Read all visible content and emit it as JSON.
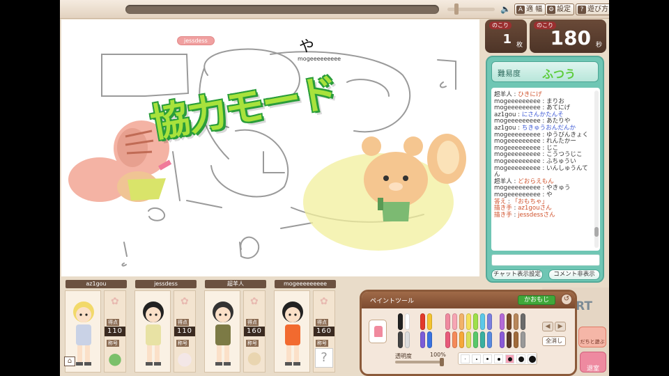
{
  "topbar": {
    "buttons": [
      {
        "label": "適 幅",
        "icon": "A"
      },
      {
        "label": "設定",
        "icon": "⚙"
      },
      {
        "label": "遊び方",
        "icon": "?"
      }
    ]
  },
  "canvas": {
    "drawer_tag": "jessdess",
    "hint_char": "や",
    "hint_name": "mogeeeeeeeee",
    "mode_title": "協力モード"
  },
  "counters": {
    "sheets": {
      "label": "のこり",
      "value": "1",
      "unit": "枚"
    },
    "time": {
      "label": "のこり",
      "value": "180",
      "unit": "秒"
    }
  },
  "difficulty": {
    "label": "難易度",
    "value": "ふつう"
  },
  "chat": {
    "lines": [
      {
        "who": "超羊人",
        "sep": " : ",
        "msg": "ひきにげ",
        "style": "red"
      },
      {
        "who": "mogeeeeeeeee",
        "sep": " : ",
        "msg": "まりお",
        "style": ""
      },
      {
        "who": "mogeeeeeeeee",
        "sep": " : ",
        "msg": "あてにげ",
        "style": ""
      },
      {
        "who": "az1gou",
        "sep": " : ",
        "msg": "にさんかたんそ",
        "style": "blue"
      },
      {
        "who": "mogeeeeeeeee",
        "sep": " : ",
        "msg": "あたりや",
        "style": ""
      },
      {
        "who": "az1gou",
        "sep": " : ",
        "msg": "ちきゅうおんだんか",
        "style": "blue"
      },
      {
        "who": "mogeeeeeeeee",
        "sep": " : ",
        "msg": "ゆうびんきょく",
        "style": ""
      },
      {
        "who": "mogeeeeeeeee",
        "sep": " : ",
        "msg": "れんたかー",
        "style": ""
      },
      {
        "who": "mogeeeeeeeee",
        "sep": " : ",
        "msg": "じこ",
        "style": ""
      },
      {
        "who": "mogeeeeeeeee",
        "sep": " : ",
        "msg": "こうつうじこ",
        "style": ""
      },
      {
        "who": "mogeeeeeeeee",
        "sep": " : ",
        "msg": "ふちゅうい",
        "style": ""
      },
      {
        "who": "mogeeeeeeeee",
        "sep": " : ",
        "msg": "いんしゅうんてん",
        "style": ""
      },
      {
        "who": "超羊人",
        "sep": " : ",
        "msg": "どおらえもん",
        "style": "red"
      },
      {
        "who": "mogeeeeeeeee",
        "sep": " : ",
        "msg": "やきゅう",
        "style": ""
      },
      {
        "who": "mogeeeeeeeee",
        "sep": " : ",
        "msg": "や",
        "style": ""
      },
      {
        "who": "答え",
        "sep": " : ",
        "msg": "「おもちゃ」",
        "style": "sys"
      },
      {
        "who": "描き手",
        "sep": " : ",
        "msg": "az1gouさん",
        "style": "sys"
      },
      {
        "who": "描き手",
        "sep": " : ",
        "msg": "jessdessさん",
        "style": "sys"
      }
    ],
    "input_value": "",
    "display_settings_label": "チャット表示設定",
    "comment_hide_label": "コメント非表示"
  },
  "players": [
    {
      "name": "az1gou",
      "score_label": "得点",
      "score": "110",
      "title_label": "称号",
      "hair": "#f2d96a",
      "outfit": "#c9d2e6",
      "badge": "green"
    },
    {
      "name": "jessdess",
      "score_label": "得点",
      "score": "110",
      "title_label": "称号",
      "hair": "#222222",
      "outfit": "#e8e2a4",
      "badge": "cat"
    },
    {
      "name": "超羊人",
      "score_label": "得点",
      "score": "160",
      "title_label": "称号",
      "hair": "#333333",
      "outfit": "#7c7a45",
      "badge": "face"
    },
    {
      "name": "mogeeeeeeeee",
      "score_label": "得点",
      "score": "160",
      "title_label": "称号",
      "hair": "#222222",
      "outfit": "#f26a2f",
      "badge": "?"
    }
  ],
  "paint_tool": {
    "title": "ペイントツール",
    "kaomoji_label": "かおもじ",
    "clear_all_label": "全消し",
    "opacity_label": "透明度",
    "opacity_value": "100%",
    "pens_row1": [
      "#222222",
      "#ffffff",
      "#e23a2a",
      "#f4c430",
      "#f08aa0",
      "#f7a6b4",
      "#f2b36a",
      "#f5e05a",
      "#9ee04a",
      "#5cc8e8",
      "#7b7fe0",
      "#b46ad8",
      "#7a4b2a",
      "#b8875a",
      "#6b6b6b"
    ],
    "pens_row2": [
      "#444444",
      "#dddddd",
      "#7b5cd8",
      "#3a72e0",
      "#e85a7a",
      "#f58a5a",
      "#f6a83a",
      "#d8e05a",
      "#5ac86a",
      "#3ab0a0",
      "#5a8ae0",
      "#8a5ad8",
      "#5a3a2a",
      "#a06a3a",
      "#999999"
    ],
    "sizes": [
      "1",
      "2",
      "3",
      "5",
      "7",
      "9",
      "50"
    ]
  },
  "start_area": {
    "start_text": "RT",
    "friend_label": "だちと遊ぶ",
    "exit_label": "退室"
  }
}
